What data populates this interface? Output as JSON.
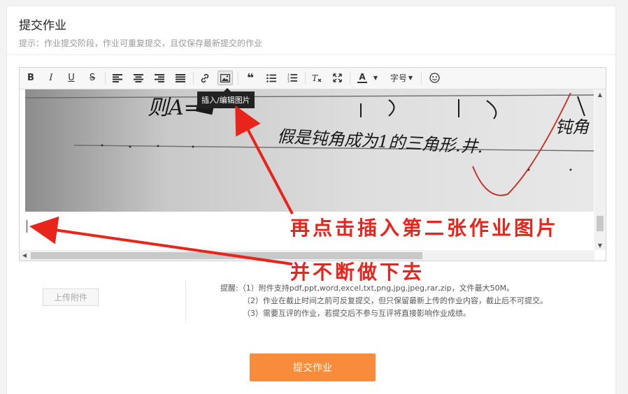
{
  "header": {
    "title": "提交作业",
    "hint": "提示：作业提交阶段，作业可重复提交，且仅保存最新提交的作业"
  },
  "toolbar": {
    "bold": "B",
    "italic": "I",
    "underline": "U",
    "strike": "S",
    "quote": "❝",
    "font_color": "A",
    "font_size": "字号",
    "tooltip": "插入/编辑图片"
  },
  "attachment": {
    "upload_label": "上传附件"
  },
  "notes": {
    "label": "提醒:",
    "items": [
      "（1）附件支持pdf,ppt,word,excel,txt,png,jpg,jpeg,rar,zip，文件最大50M。",
      "（2）作业在截止时间之前可反复提交，但只保留最新上传的作业内容，截止后不可提交。",
      "（3）需要互评的作业，若提交后不参与互评将直接影响作业成绩。"
    ]
  },
  "submit_label": "提交作业",
  "annotations": {
    "first": "再点击插入第二张作业图片",
    "second": "并不断做下去"
  },
  "photo_handwriting": {
    "line1": "则A=",
    "line2": "假是钝角成为1的三角形.井.",
    "right": "钝角"
  },
  "colors": {
    "accent": "#f98c3a",
    "annotation": "#e8241b"
  }
}
